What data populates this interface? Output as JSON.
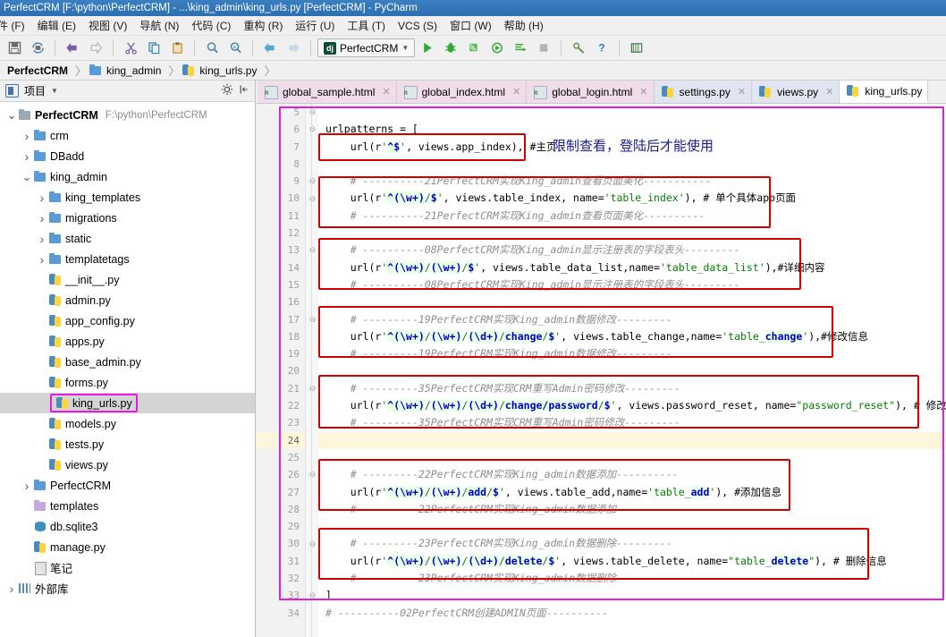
{
  "window": {
    "title": "PerfectCRM [F:\\python\\PerfectCRM] - ...\\king_admin\\king_urls.py [PerfectCRM] - PyCharm"
  },
  "menu": {
    "items": [
      {
        "label": "件 (F)"
      },
      {
        "label": "编辑 (E)"
      },
      {
        "label": "视图 (V)"
      },
      {
        "label": "导航 (N)"
      },
      {
        "label": "代码 (C)"
      },
      {
        "label": "重构 (R)"
      },
      {
        "label": "运行 (U)"
      },
      {
        "label": "工具 (T)"
      },
      {
        "label": "VCS (S)"
      },
      {
        "label": "窗口 (W)"
      },
      {
        "label": "帮助 (H)"
      }
    ]
  },
  "toolbar": {
    "run_config": "PerfectCRM",
    "dj_badge": "dj"
  },
  "breadcrumb": {
    "items": [
      {
        "label": "PerfectCRM",
        "icon": "none"
      },
      {
        "label": "king_admin",
        "icon": "folder-icon"
      },
      {
        "label": "king_urls.py",
        "icon": "python-file-icon"
      }
    ]
  },
  "project_panel": {
    "title": "项目",
    "tree": [
      {
        "depth": 0,
        "arrow": "down",
        "icon": "folder-icon",
        "label": "PerfectCRM",
        "sub": "F:\\python\\PerfectCRM",
        "bold": true,
        "selected": false
      },
      {
        "depth": 1,
        "arrow": "right",
        "icon": "folder-mod-icon",
        "label": "crm",
        "sub": "",
        "bold": false,
        "selected": false
      },
      {
        "depth": 1,
        "arrow": "right",
        "icon": "folder-mod-icon",
        "label": "DBadd",
        "sub": "",
        "bold": false,
        "selected": false
      },
      {
        "depth": 1,
        "arrow": "down",
        "icon": "folder-mod-icon",
        "label": "king_admin",
        "sub": "",
        "bold": false,
        "selected": false
      },
      {
        "depth": 2,
        "arrow": "right",
        "icon": "folder-mod-icon",
        "label": "king_templates",
        "sub": "",
        "bold": false,
        "selected": false
      },
      {
        "depth": 2,
        "arrow": "right",
        "icon": "folder-mod-icon",
        "label": "migrations",
        "sub": "",
        "bold": false,
        "selected": false
      },
      {
        "depth": 2,
        "arrow": "right",
        "icon": "folder-mod-icon",
        "label": "static",
        "sub": "",
        "bold": false,
        "selected": false
      },
      {
        "depth": 2,
        "arrow": "right",
        "icon": "folder-mod-icon",
        "label": "templatetags",
        "sub": "",
        "bold": false,
        "selected": false
      },
      {
        "depth": 2,
        "arrow": "none",
        "icon": "python-file-icon",
        "label": "__init__.py",
        "sub": "",
        "bold": false,
        "selected": false
      },
      {
        "depth": 2,
        "arrow": "none",
        "icon": "python-file-icon",
        "label": "admin.py",
        "sub": "",
        "bold": false,
        "selected": false
      },
      {
        "depth": 2,
        "arrow": "none",
        "icon": "python-file-icon",
        "label": "app_config.py",
        "sub": "",
        "bold": false,
        "selected": false
      },
      {
        "depth": 2,
        "arrow": "none",
        "icon": "python-file-icon",
        "label": "apps.py",
        "sub": "",
        "bold": false,
        "selected": false
      },
      {
        "depth": 2,
        "arrow": "none",
        "icon": "python-file-icon",
        "label": "base_admin.py",
        "sub": "",
        "bold": false,
        "selected": false
      },
      {
        "depth": 2,
        "arrow": "none",
        "icon": "python-file-icon",
        "label": "forms.py",
        "sub": "",
        "bold": false,
        "selected": false
      },
      {
        "depth": 2,
        "arrow": "none",
        "icon": "python-file-icon",
        "label": "king_urls.py",
        "sub": "",
        "bold": false,
        "selected": true
      },
      {
        "depth": 2,
        "arrow": "none",
        "icon": "python-file-icon",
        "label": "models.py",
        "sub": "",
        "bold": false,
        "selected": false
      },
      {
        "depth": 2,
        "arrow": "none",
        "icon": "python-file-icon",
        "label": "tests.py",
        "sub": "",
        "bold": false,
        "selected": false
      },
      {
        "depth": 2,
        "arrow": "none",
        "icon": "python-file-icon",
        "label": "views.py",
        "sub": "",
        "bold": false,
        "selected": false
      },
      {
        "depth": 1,
        "arrow": "right",
        "icon": "folder-mod-icon",
        "label": "PerfectCRM",
        "sub": "",
        "bold": false,
        "selected": false
      },
      {
        "depth": 1,
        "arrow": "none",
        "icon": "folder-purple-icon",
        "label": "templates",
        "sub": "",
        "bold": false,
        "selected": false
      },
      {
        "depth": 1,
        "arrow": "none",
        "icon": "db-icon",
        "label": "db.sqlite3",
        "sub": "",
        "bold": false,
        "selected": false
      },
      {
        "depth": 1,
        "arrow": "none",
        "icon": "python-file-icon",
        "label": "manage.py",
        "sub": "",
        "bold": false,
        "selected": false
      },
      {
        "depth": 1,
        "arrow": "none",
        "icon": "note-icon",
        "label": "笔记",
        "sub": "",
        "bold": false,
        "selected": false
      },
      {
        "depth": 0,
        "arrow": "right",
        "icon": "library-icon",
        "label": "外部库",
        "sub": "",
        "bold": false,
        "selected": false
      }
    ]
  },
  "editor_tabs": [
    {
      "label": "global_sample.html",
      "type": "html",
      "active": false
    },
    {
      "label": "global_index.html",
      "type": "html",
      "active": false
    },
    {
      "label": "global_login.html",
      "type": "html",
      "active": false
    },
    {
      "label": "settings.py",
      "type": "py",
      "active": false
    },
    {
      "label": "views.py",
      "type": "py",
      "active": false
    },
    {
      "label": "king_urls.py",
      "type": "py",
      "active": true
    }
  ],
  "editor": {
    "first_line": 5,
    "last_line": 34,
    "current_line": 24,
    "annotation": "限制查看，登陆后才能使用",
    "lines": [
      {
        "n": 5,
        "text": ""
      },
      {
        "n": 6,
        "text": "urlpatterns = ["
      },
      {
        "n": 7,
        "text": "    url(r'^$', views.app_index), #主页"
      },
      {
        "n": 8,
        "text": ""
      },
      {
        "n": 9,
        "text": "    # ----------21PerfectCRM实现King_admin查看页面美化-----------"
      },
      {
        "n": 10,
        "text": "    url(r'^(\\w+)/$', views.table_index, name='table_index'),   # 单个具体app页面"
      },
      {
        "n": 11,
        "text": "    # ----------21PerfectCRM实现King_admin查看页面美化----------"
      },
      {
        "n": 12,
        "text": ""
      },
      {
        "n": 13,
        "text": "    # ----------08PerfectCRM实现King_admin显示注册表的字段表头---------"
      },
      {
        "n": 14,
        "text": "    url(r'^(\\w+)/(\\w+)/$', views.table_data_list,name='table_data_list'),#详细内容"
      },
      {
        "n": 15,
        "text": "    # ----------08PerfectCRM实现King_admin显示注册表的字段表头---------"
      },
      {
        "n": 16,
        "text": ""
      },
      {
        "n": 17,
        "text": "    # ---------19PerfectCRM实现King_admin数据修改---------"
      },
      {
        "n": 18,
        "text": "    url(r'^(\\w+)/(\\w+)/(\\d+)/change/$', views.table_change,name='table_change'),#修改信息"
      },
      {
        "n": 19,
        "text": "    # ---------19PerfectCRM实现King_admin数据修改---------"
      },
      {
        "n": 20,
        "text": ""
      },
      {
        "n": 21,
        "text": "    # ---------35PerfectCRM实现CRM重写Admin密码修改---------"
      },
      {
        "n": 22,
        "text": "    url(r'^(\\w+)/(\\w+)/(\\d+)/change/password/$', views.password_reset, name=\"password_reset\"),   # 修改密码"
      },
      {
        "n": 23,
        "text": "    # ---------35PerfectCRM实现CRM重写Admin密码修改---------"
      },
      {
        "n": 24,
        "text": ""
      },
      {
        "n": 25,
        "text": ""
      },
      {
        "n": 26,
        "text": "    # ---------22PerfectCRM实现King_admin数据添加----------"
      },
      {
        "n": 27,
        "text": "    url(r'^(\\w+)/(\\w+)/add/$', views.table_add,name='table_add'),   #添加信息"
      },
      {
        "n": 28,
        "text": "    # ---------22PerfectCRM实现King_admin数据添加---------"
      },
      {
        "n": 29,
        "text": ""
      },
      {
        "n": 30,
        "text": "    # ---------23PerfectCRM实现King_admin数据删除---------"
      },
      {
        "n": 31,
        "text": "    url(r'^(\\w+)/(\\w+)/(\\d+)/delete/$', views.table_delete, name=\"table_delete\"),   # 删除信息"
      },
      {
        "n": 32,
        "text": "    # ---------23PerfectCRM实现King_admin数据删除---------"
      },
      {
        "n": 33,
        "text": "]"
      },
      {
        "n": 34,
        "text": "# ----------02PerfectCRM创建ADMIN页面----------"
      }
    ]
  },
  "colors": {
    "highlight_red": "#d40000",
    "highlight_magenta": "#e01ee0",
    "annotation_blue": "#1a1a8c",
    "title_blue": "#2d6fb0"
  }
}
